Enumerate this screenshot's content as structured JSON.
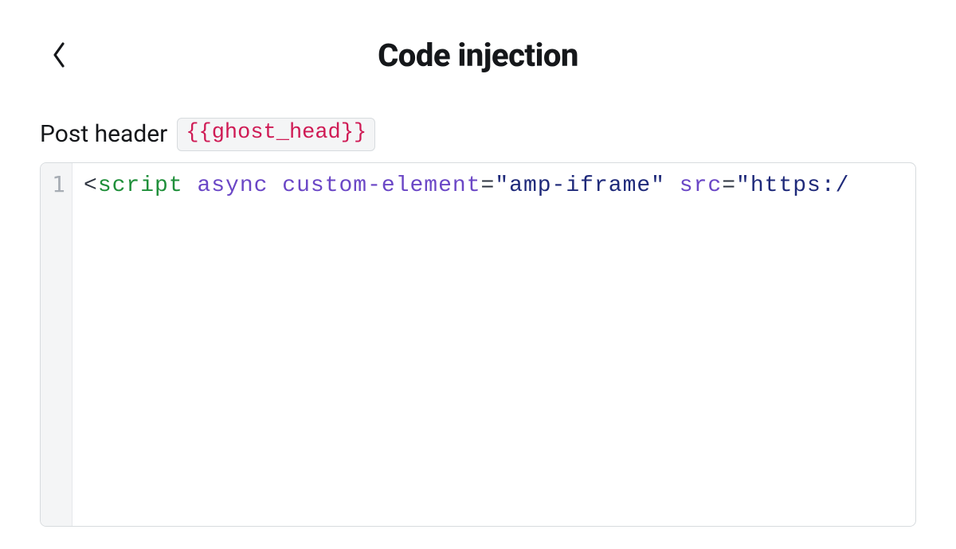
{
  "header": {
    "title": "Code injection"
  },
  "section": {
    "label": "Post header",
    "badge": "{{ghost_head}}"
  },
  "editor": {
    "gutter": [
      "1"
    ],
    "line1": {
      "open_punc": "<",
      "tag": "script",
      "sp1": " ",
      "attr_async": "async",
      "sp2": " ",
      "attr_custom": "custom-element",
      "eq1": "=",
      "val_custom": "\"amp-iframe\"",
      "sp3": " ",
      "attr_src": "src",
      "eq2": "=",
      "val_src": "\"https:/"
    }
  }
}
